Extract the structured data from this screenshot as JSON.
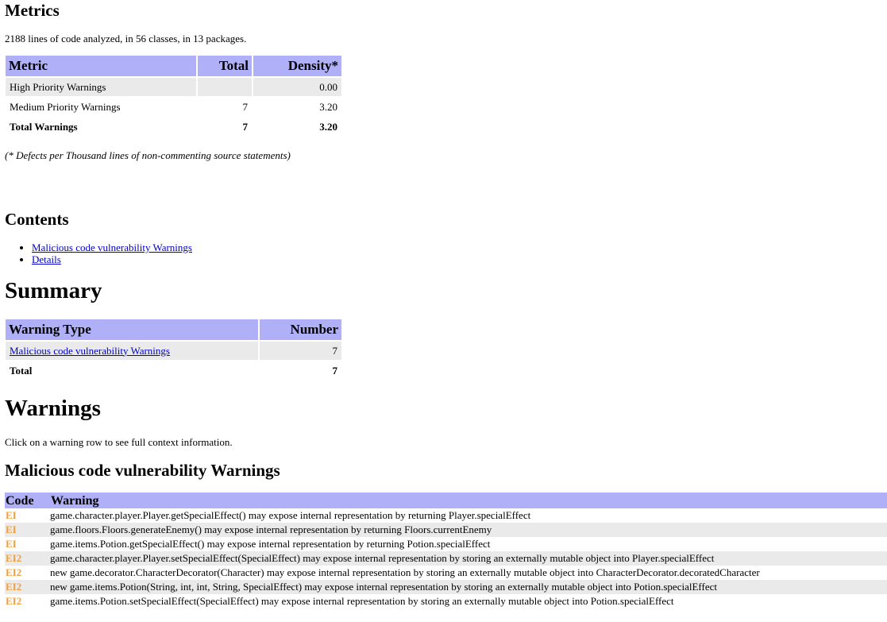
{
  "metrics": {
    "heading": "Metrics",
    "summary_line": "2188 lines of code analyzed, in 56 classes, in 13 packages.",
    "columns": [
      "Metric",
      "Total",
      "Density*"
    ],
    "rows": [
      {
        "metric": "High Priority Warnings",
        "total": "",
        "density": "0.00"
      },
      {
        "metric": "Medium Priority Warnings",
        "total": "7",
        "density": "3.20"
      },
      {
        "metric": "Total Warnings",
        "total": "7",
        "density": "3.20"
      }
    ],
    "footnote": "(* Defects per Thousand lines of non-commenting source statements)"
  },
  "contents": {
    "heading": "Contents",
    "links": [
      "Malicious code vulnerability Warnings",
      "Details"
    ]
  },
  "summary": {
    "heading": "Summary",
    "columns": [
      "Warning Type",
      "Number"
    ],
    "rows": [
      {
        "type": "Malicious code vulnerability Warnings",
        "number": "7"
      }
    ],
    "total_label": "Total",
    "total_value": "7"
  },
  "warnings": {
    "heading": "Warnings",
    "intro": "Click on a warning row to see full context information.",
    "subheading": "Malicious code vulnerability Warnings",
    "columns": [
      "Code",
      "Warning"
    ],
    "rows": [
      {
        "code": "EI",
        "text": "game.character.player.Player.getSpecialEffect() may expose internal representation by returning Player.specialEffect"
      },
      {
        "code": "EI",
        "text": "game.floors.Floors.generateEnemy() may expose internal representation by returning Floors.currentEnemy"
      },
      {
        "code": "EI",
        "text": "game.items.Potion.getSpecialEffect() may expose internal representation by returning Potion.specialEffect"
      },
      {
        "code": "EI2",
        "text": "game.character.player.Player.setSpecialEffect(SpecialEffect) may expose internal representation by storing an externally mutable object into Player.specialEffect"
      },
      {
        "code": "EI2",
        "text": "new game.decorator.CharacterDecorator(Character) may expose internal representation by storing an externally mutable object into CharacterDecorator.decoratedCharacter"
      },
      {
        "code": "EI2",
        "text": "new game.items.Potion(String, int, int, String, SpecialEffect) may expose internal representation by storing an externally mutable object into Potion.specialEffect"
      },
      {
        "code": "EI2",
        "text": "game.items.Potion.setSpecialEffect(SpecialEffect) may expose internal representation by storing an externally mutable object into Potion.specialEffect"
      }
    ]
  },
  "colors": {
    "table_header_bg": "#b0b0f8",
    "row_alt_bg": "#eaeaea",
    "code_color": "#f0a040",
    "link_color": "#0000cc"
  }
}
